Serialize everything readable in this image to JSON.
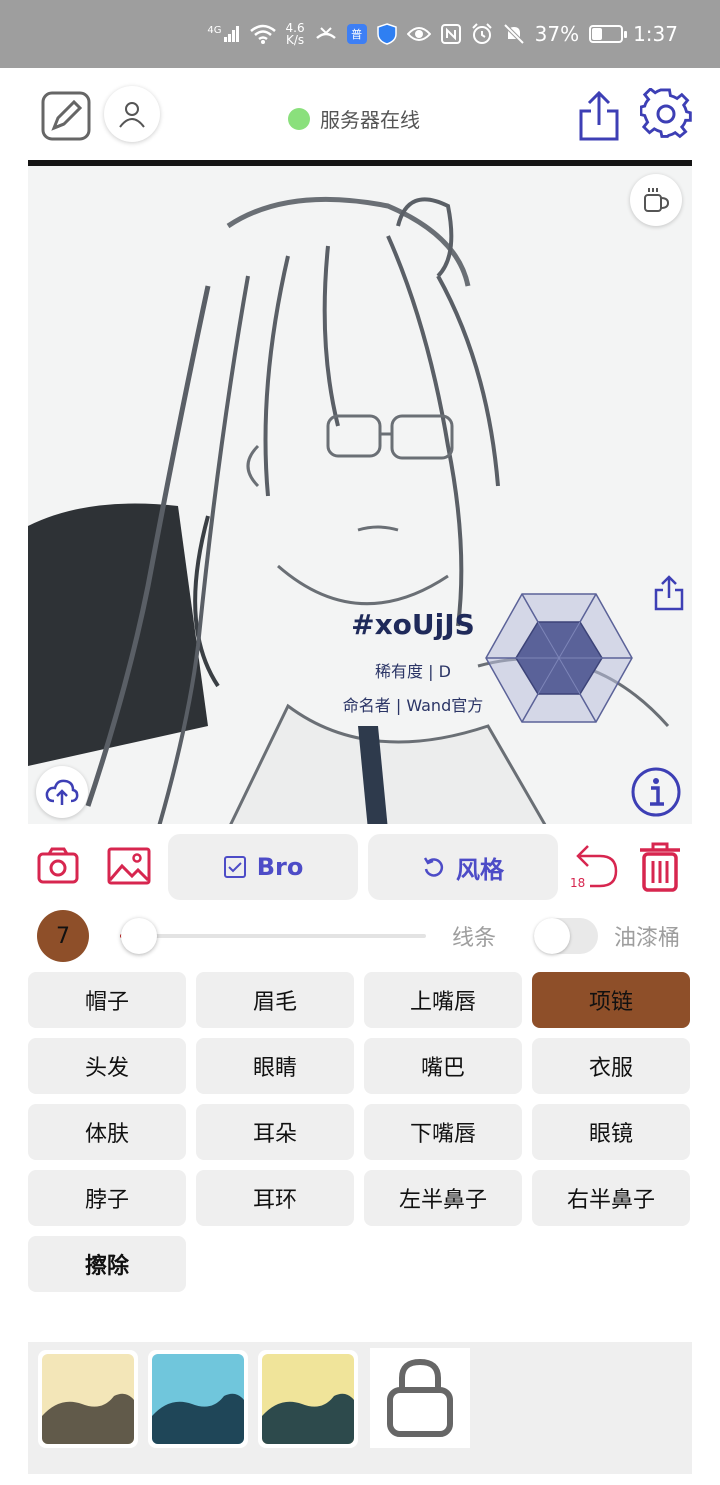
{
  "status_bar": {
    "signal": "4G",
    "net_speed_value": "4.6",
    "net_speed_unit": "K/s",
    "app_badge": "普",
    "battery": "37%",
    "battery_level": 0.37,
    "time": "1:37"
  },
  "header": {
    "server_status": "服务器在线",
    "server_status_color": "#8ae07c"
  },
  "canvas": {
    "card": {
      "id": "#xoUjJS",
      "rarity": "稀有度 | D",
      "namer": "命名者 | Wand官方"
    }
  },
  "toolbar": {
    "bro_label": "Bro",
    "style_label": "风格",
    "undo_count": "18",
    "accent_color": "#d7264f",
    "button_text_color": "#4d4cc7"
  },
  "brush": {
    "size": "7",
    "size_color": "#8e4f29",
    "slider_value": 0.05,
    "line_label": "线条",
    "bucket_label": "油漆桶",
    "bucket_enabled": false
  },
  "labels": [
    {
      "text": "帽子",
      "active": false
    },
    {
      "text": "眉毛",
      "active": false
    },
    {
      "text": "上嘴唇",
      "active": false
    },
    {
      "text": "项链",
      "active": true
    },
    {
      "text": "头发",
      "active": false
    },
    {
      "text": "眼睛",
      "active": false
    },
    {
      "text": "嘴巴",
      "active": false
    },
    {
      "text": "衣服",
      "active": false
    },
    {
      "text": "体肤",
      "active": false
    },
    {
      "text": "耳朵",
      "active": false
    },
    {
      "text": "下嘴唇",
      "active": false
    },
    {
      "text": "眼镜",
      "active": false
    },
    {
      "text": "脖子",
      "active": false
    },
    {
      "text": "耳环",
      "active": false
    },
    {
      "text": "左半鼻子",
      "active": false
    },
    {
      "text": "右半鼻子",
      "active": false
    },
    {
      "text": "擦除",
      "active": false,
      "bold": true
    }
  ],
  "palettes": [
    {
      "top": "#f3e6b8",
      "bottom": "#615a4a"
    },
    {
      "top": "#70c6dc",
      "bottom": "#1f4658"
    },
    {
      "top": "#f0e49a",
      "bottom": "#2d4a4c"
    }
  ]
}
